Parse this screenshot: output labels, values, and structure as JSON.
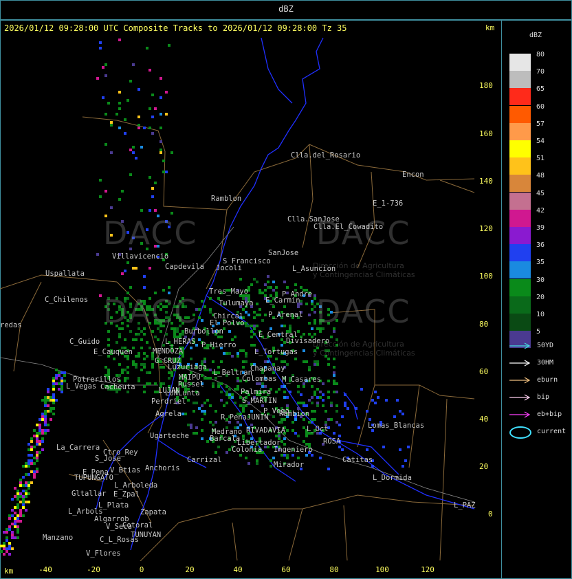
{
  "header": {
    "title": "dBZ"
  },
  "map": {
    "title_line": "2026/01/12 09:28:00 UTC Composite Tracks to 2026/01/12 09:28:00 Tz 35",
    "unit_top": "km",
    "unit_bottom": "km",
    "y_ticks": [
      "180",
      "160",
      "140",
      "120",
      "100",
      "80",
      "60",
      "40",
      "20",
      "0"
    ],
    "x_ticks": [
      "-40",
      "-20",
      "0",
      "20",
      "40",
      "60",
      "80",
      "100",
      "120"
    ],
    "places": [
      "Clla.del_Rosario",
      "Encon",
      "Ramblon",
      "E_1-736",
      "Clla.SanJose",
      "Clla.El_Cowadito",
      "Villavicencio",
      "S_Francisco",
      "SanJose",
      "Uspallata",
      "Capdevila",
      "Jocoli",
      "L_Asuncion",
      "Tres_Mayo",
      "Tulumaya",
      "E_Carmin",
      "C_Chilenos",
      "P_Andre",
      "Chircal",
      "P_Arenal",
      "redas",
      "El Polvo",
      "Burbollon",
      "E_Central",
      "C_Guido",
      "L_HERAS",
      "P_Hierro",
      "Divisadero",
      "E_Cauquen",
      "MENDOZA",
      "L_Tortugas",
      "G_CRUZ",
      "Luzuriaga",
      "L_Beltran",
      "Chapanay",
      "Potrerillos",
      "MAIPU",
      "Colombas",
      "M_Casares",
      "L_Vegas",
      "Cacheuta",
      "Russel",
      "Palmira",
      "LUJAN",
      "LUNLunta",
      "Perdriel",
      "S_MARTIN",
      "Agrela",
      "P_Vega",
      "Rambion",
      "R_Pena",
      "JUNIN",
      "Ugarteche",
      "RIVADAVIA",
      "Lomas_Blancas",
      "La_Carrera",
      "Ctro_Rey",
      "S_Jose",
      "Barcala",
      "Anchoris",
      "Carrizal",
      "Medrano",
      "L_Oct",
      "ROSA",
      "Catitas",
      "Ingeniero",
      "E_Pena",
      "V_Btias",
      "TUPUNGATO",
      "L_Arboleda",
      "L_Dormida",
      "Gltallar",
      "E_Zpal",
      "L_Plata",
      "L_PAZ",
      "L_Arbols",
      "Zapata",
      "Algarrob",
      "V_Seca",
      "Cotoral",
      "Manzano",
      "TUNUYAN",
      "C_L_Rosas",
      "V_Flores",
      "Colonia",
      "Libertador",
      "Mirador"
    ],
    "watermark": {
      "logo": "DACC",
      "line1": "Dirección de Agricultura",
      "line2": "y Contingencias Climáticas"
    }
  },
  "legend": {
    "title": "dBZ",
    "scale": [
      {
        "value": "80",
        "color": "#e6e6e6"
      },
      {
        "value": "70",
        "color": "#bdbdbd"
      },
      {
        "value": "65",
        "color": "#ff2a1a"
      },
      {
        "value": "60",
        "color": "#ff5a00"
      },
      {
        "value": "57",
        "color": "#ff9a4a"
      },
      {
        "value": "54",
        "color": "#ffff00"
      },
      {
        "value": "51",
        "color": "#ffc21a"
      },
      {
        "value": "48",
        "color": "#d8863a"
      },
      {
        "value": "45",
        "color": "#c47090"
      },
      {
        "value": "42",
        "color": "#d01890"
      },
      {
        "value": "39",
        "color": "#8a1ad0"
      },
      {
        "value": "36",
        "color": "#2040f0"
      },
      {
        "value": "35",
        "color": "#1a8ae0"
      },
      {
        "value": "30",
        "color": "#0a8a1a"
      },
      {
        "value": "20",
        "color": "#0a6a1a"
      },
      {
        "value": "10",
        "color": "#0a4a14"
      },
      {
        "value": "5",
        "color": "#4a3a90"
      }
    ],
    "tracks": [
      {
        "label": "50YD",
        "color": "#40e0e0"
      },
      {
        "label": "30HM",
        "color": "#ffffff"
      },
      {
        "label": "eburn",
        "color": "#f0c080"
      },
      {
        "label": "bip",
        "color": "#ffd0f0"
      },
      {
        "label": "eb+bip",
        "color": "#ff40ff"
      }
    ],
    "current_label": "current"
  }
}
